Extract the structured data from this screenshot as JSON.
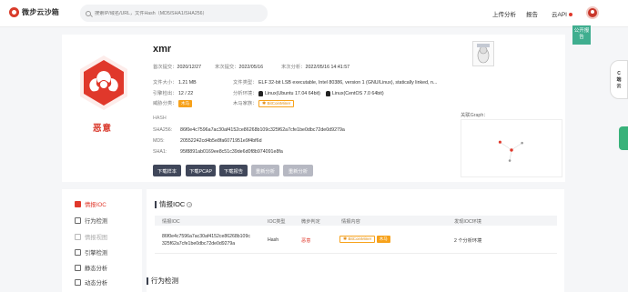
{
  "header": {
    "logo_text": "微步云沙箱",
    "search_placeholder": "搜索IP/域名/URL，文件Hash（MD5/SHA1/SHA256）",
    "nav_upload": "上传分析",
    "nav_report": "报告",
    "nav_cloud": "云API",
    "public_badge": "公开报告"
  },
  "file": {
    "name": "xmr",
    "threat_level": "恶意",
    "first_submit_label": "首次提交：",
    "first_submit": "2020/12/27",
    "last_submit_label": "末次提交：",
    "last_submit": "2022/05/16",
    "last_analysis_label": "末次分析：",
    "last_analysis": "2022/05/16 14:41:57",
    "size_label": "文件大小：",
    "size": "1.21 MB",
    "type_label": "文件类型：",
    "type": "ELF 32-bit LSB executable, Intel 80386, version 1 (GNU/Linux), statically linked, n...",
    "engine_label": "引擎检出：",
    "engine": "12 / 22",
    "env_label": "分析环境：",
    "env_1": "Linux(Ubuntu 17.04 64bit)",
    "env_2": "Linux(CentOS 7.0 64bit)",
    "threat_class_label": "威胁分类：",
    "threat_class": "木马",
    "family_label": "木马家族：",
    "family": "BitCoinMiner",
    "hash_heading": "HASH",
    "sha256_label": "SHA256:",
    "sha256": "86f0e4c7596a7ac30af4152ce86268b109c325f62a7cfe1be0dbc72de0d9279a",
    "md5_label": "MD5:",
    "md5": "20552242cd4b5e8fa6071951e9f4bf6d",
    "sha1_label": "SHA1:",
    "sha1": "95f8891ab0169ee8c51c39de6d0f8b974091e8fa"
  },
  "actions": {
    "download_sample": "下载样本",
    "download_pcap": "下载PCAP",
    "download_report": "下载报告",
    "reanalyze": "重新分析",
    "sandbox_analyze": "重新分析"
  },
  "graph_label": "关联Graph：",
  "side_float": "C\n端\n云",
  "left_nav": [
    {
      "label": "情报IOC",
      "icon": "intel-icon",
      "active": true
    },
    {
      "label": "行为检测",
      "icon": "behavior-icon",
      "active": false
    },
    {
      "label": "情报视图",
      "icon": "view-icon",
      "active": false
    },
    {
      "label": "引擎检测",
      "icon": "engine-icon",
      "active": false
    },
    {
      "label": "静态分析",
      "icon": "static-icon",
      "active": false
    },
    {
      "label": "动态分析",
      "icon": "dynamic-icon",
      "active": false
    }
  ],
  "ioc": {
    "title": "情报IOC",
    "columns": [
      "情报IOC",
      "IOC类型",
      "微步判定",
      "情报内容",
      "发现IOC环境"
    ],
    "row": {
      "ioc_line1": "86f0e4c7596a7ac30af4152ce86268b109c",
      "ioc_line2": "325f62a7cfe1be0dbc72de0d9279a",
      "type": "Hash",
      "verdict": "恶意",
      "content_tag": "BitCoinMiner",
      "content_class": "木马",
      "env": "2 个分析环境"
    }
  },
  "behavior_title": "行为检测",
  "colors": {
    "accent": "#e0382b",
    "dark_button": "#40475a",
    "public": "#3fae8f"
  }
}
